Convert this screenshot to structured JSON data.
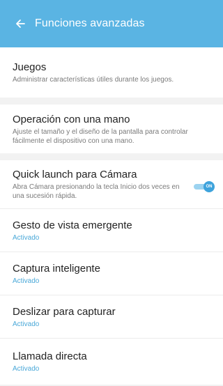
{
  "header": {
    "title": "Funciones avanzadas"
  },
  "items": [
    {
      "title": "Juegos",
      "subtitle": "Administrar características útiles durante los juegos."
    },
    {
      "title": "Operación con una mano",
      "subtitle": "Ajuste el tamaño y el diseño de la pantalla para controlar fácilmente el dispositivo con una mano."
    },
    {
      "title": "Quick launch para Cámara",
      "subtitle": "Abra Cámara presionando la tecla Inicio dos veces en una sucesión rápida.",
      "toggle": "ON"
    },
    {
      "title": "Gesto de vista emergente",
      "status": "Activado"
    },
    {
      "title": "Captura inteligente",
      "status": "Activado"
    },
    {
      "title": "Deslizar para capturar",
      "status": "Activado"
    },
    {
      "title": "Llamada directa",
      "status": "Activado"
    }
  ],
  "colors": {
    "header": "#5ab4e3",
    "accent": "#4aa8d8",
    "background": "#f2f2f2"
  }
}
